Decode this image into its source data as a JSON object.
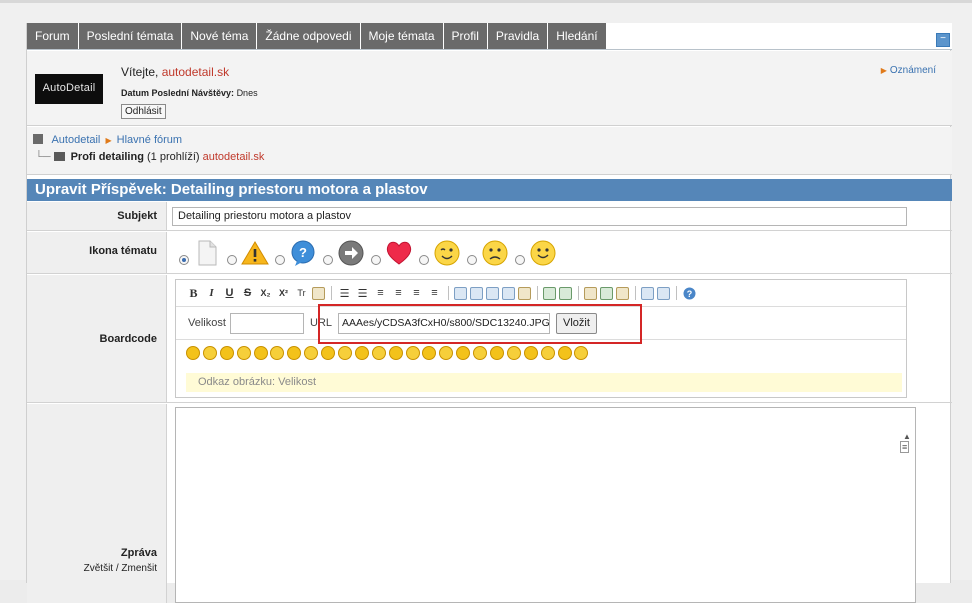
{
  "nav": {
    "tabs": [
      "Forum",
      "Poslední témata",
      "Nové téma",
      "Žádne odpovedi",
      "Moje témata",
      "Profil",
      "Pravidla",
      "Hledání"
    ],
    "collapse_label": "−"
  },
  "header": {
    "logo_text": "AutoDetail",
    "welcome_prefix": "Vítejte,",
    "username": "autodetail.sk",
    "last_visit_label": "Datum Poslední Návštěvy:",
    "last_visit_value": "Dnes",
    "logout_label": "Odhlásit",
    "announcements_label": "Oznámení"
  },
  "breadcrumb": {
    "root": "Autodetail",
    "forum": "Hlavné fórum",
    "topic": "Profi detailing",
    "viewers": "(1 prohlíží)",
    "viewer_user": "autodetail.sk"
  },
  "edit": {
    "title": "Upravit Příspěvek: Detailing priestoru motora a plastov",
    "subject_label": "Subjekt",
    "subject_value": "Detailing priestoru motora a plastov",
    "icon_label": "Ikona tématu",
    "boardcode_label": "Boardcode",
    "size_label": "Velikost",
    "url_label": "URL",
    "url_value": "AAAes/yCDSA3fCxH0/s800/SDC13240.JPG",
    "insert_button": "Vložit",
    "hint_text": "Odkaz obrázku: Velikost",
    "message_label": "Zpráva",
    "zoom_label": "Zvětšit / Zmenšit"
  },
  "topic_icons": [
    "blank-page",
    "warning",
    "question",
    "arrow-right",
    "heart",
    "wink",
    "sad",
    "smile"
  ],
  "emoticon_count": 24,
  "colors": {
    "tab_bg": "#6a6a6a",
    "title_bar": "#5586b8",
    "username": "#c0392b",
    "link": "#3a72b0",
    "highlight_box": "#d42626"
  }
}
